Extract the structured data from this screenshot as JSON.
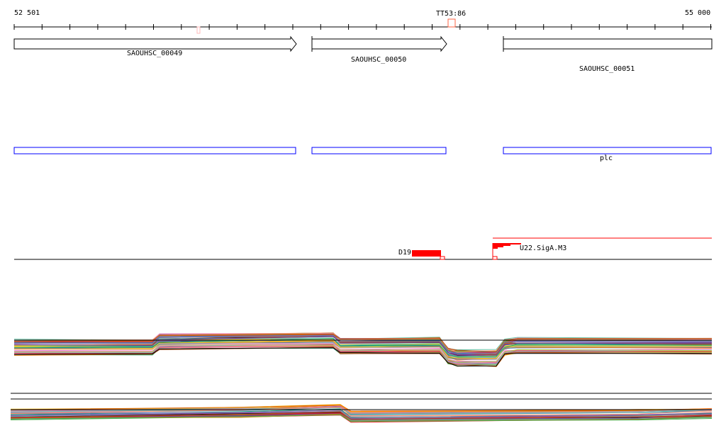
{
  "ruler": {
    "start_label": "52 501",
    "end_label": "55 000",
    "marker_label": "TT53:86"
  },
  "genes": [
    {
      "name": "SAOUHSC_00049"
    },
    {
      "name": "SAOUHSC_00050"
    },
    {
      "name": "SAOUHSC_00051"
    }
  ],
  "annotation_track": {
    "label": "plc"
  },
  "features": {
    "terminator_label": "D19",
    "promoter_label": "U22.SigA.M3"
  },
  "colors": {
    "accent": "#ff0000",
    "gene_box": "#0000ff",
    "tick_marker": "#ff6644"
  }
}
